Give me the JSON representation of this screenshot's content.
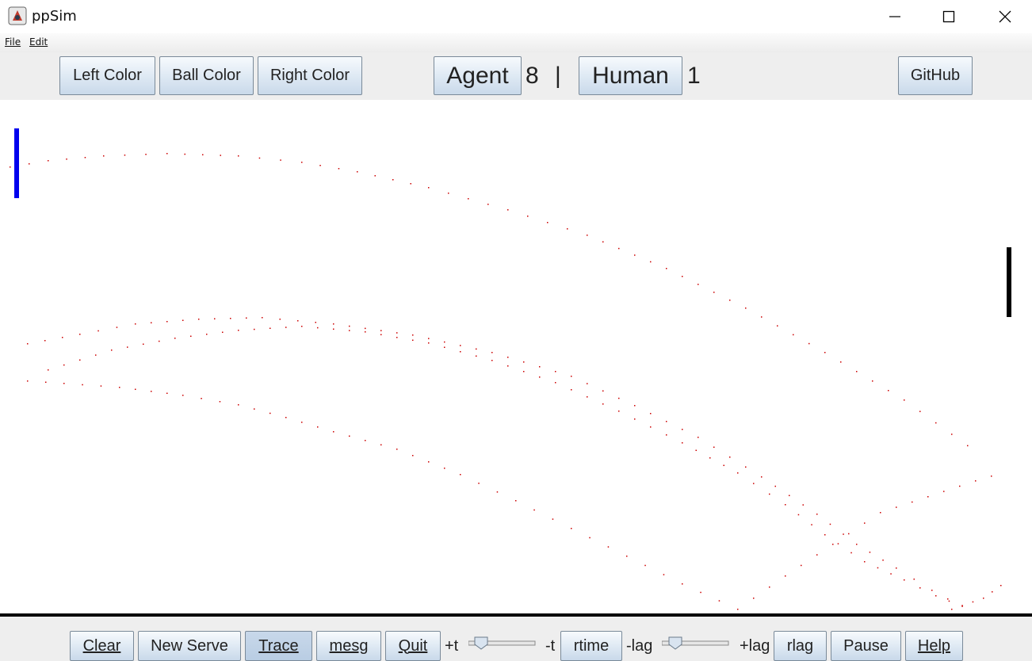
{
  "window": {
    "title": "ppSim",
    "controls": [
      "minimize-icon",
      "maximize-icon",
      "close-icon"
    ]
  },
  "menu": {
    "file": "File",
    "edit": "Edit"
  },
  "toolbar": {
    "left_color": "Left Color",
    "ball_color": "Ball Color",
    "right_color": "Right Color",
    "github": "GitHub"
  },
  "score": {
    "agent_label": "Agent",
    "agent_score": "8",
    "separator": "|",
    "human_label": "Human",
    "human_score": "1"
  },
  "field": {
    "left_paddle_color": "#0000ee",
    "right_paddle_color": "#000000",
    "trace_color": "#cc0000"
  },
  "controls": {
    "clear": "Clear",
    "new_serve": "New Serve",
    "trace": "Trace",
    "mesg": "mesg",
    "quit": "Quit",
    "plus_t": "+t",
    "minus_t": "-t",
    "rtime": "rtime",
    "minus_lag": "-lag",
    "plus_lag": "+lag",
    "rlag": "rlag",
    "pause": "Pause",
    "help": "Help",
    "trace_pressed": true
  },
  "colors": {
    "toolbar_bg": "#eeeeee",
    "button_border": "#7a8a99"
  }
}
